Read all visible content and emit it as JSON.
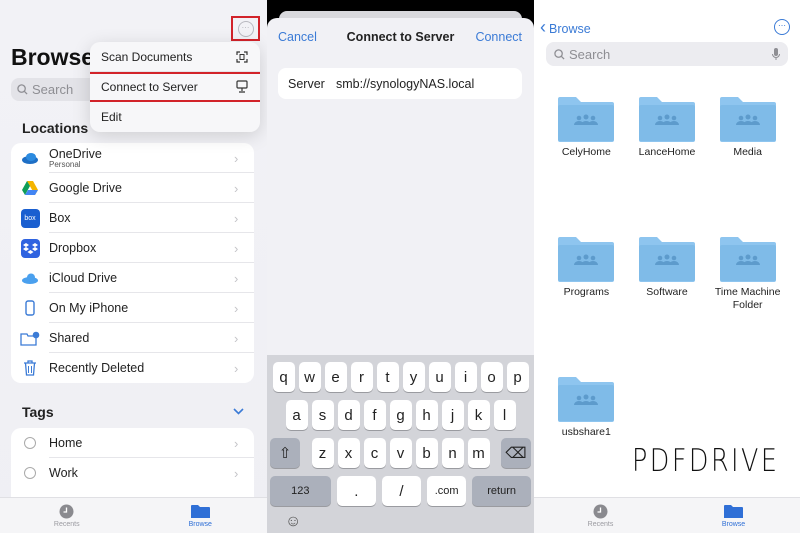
{
  "panel_browse": {
    "title": "Browse",
    "search_placeholder": "Search",
    "locations_title": "Locations",
    "locations": [
      {
        "label": "OneDrive",
        "sublabel": "Personal",
        "icon": "onedrive-icon"
      },
      {
        "label": "Google Drive",
        "icon": "google-drive-icon"
      },
      {
        "label": "Box",
        "icon": "box-icon",
        "icon_text": "box"
      },
      {
        "label": "Dropbox",
        "icon": "dropbox-icon"
      },
      {
        "label": "iCloud Drive",
        "icon": "icloud-icon"
      },
      {
        "label": "On My iPhone",
        "icon": "iphone-icon"
      },
      {
        "label": "Shared",
        "icon": "shared-folder-icon"
      },
      {
        "label": "Recently Deleted",
        "icon": "trash-icon"
      }
    ],
    "tags_title": "Tags",
    "tags": [
      {
        "label": "Home"
      },
      {
        "label": "Work"
      }
    ],
    "menu": {
      "items": [
        {
          "label": "Scan Documents",
          "icon": "scan-document-icon"
        },
        {
          "label": "Connect to Server",
          "icon": "server-display-icon",
          "highlighted": true
        },
        {
          "label": "Edit"
        }
      ]
    },
    "more_button": "⋯",
    "chevron": "›",
    "tabbar": [
      {
        "label": "Recents"
      },
      {
        "label": "Browse",
        "active": true
      }
    ]
  },
  "panel_connect": {
    "cancel_label": "Cancel",
    "title": "Connect to Server",
    "connect_label": "Connect",
    "server_label": "Server",
    "server_value": "smb://synologyNAS.local",
    "keyboard": {
      "row1": [
        "q",
        "w",
        "e",
        "r",
        "t",
        "y",
        "u",
        "i",
        "o",
        "p"
      ],
      "row2": [
        "a",
        "s",
        "d",
        "f",
        "g",
        "h",
        "j",
        "k",
        "l"
      ],
      "row3": [
        "z",
        "x",
        "c",
        "v",
        "b",
        "n",
        "m"
      ],
      "shift": "⇧",
      "backspace": "⌫",
      "numbers": "123",
      "dot": ".",
      "slash": "/",
      "dotcom": ".com",
      "return": "return",
      "emoji": "☺"
    }
  },
  "panel_server": {
    "back_label": "Browse",
    "back_chevron": "‹",
    "more_button": "⋯",
    "search_placeholder": "Search",
    "folders": [
      {
        "name": "CelyHome"
      },
      {
        "name": "LanceHome"
      },
      {
        "name": "Media"
      },
      {
        "name": "Programs"
      },
      {
        "name": "Software"
      },
      {
        "name": "Time Machine Folder"
      },
      {
        "name": "usbshare1"
      }
    ],
    "tabbar": [
      {
        "label": "Recents"
      },
      {
        "label": "Browse",
        "active": true
      }
    ]
  },
  "watermark": "PDFDRIVE",
  "colors": {
    "accent": "#3b7bd6",
    "highlight_box": "#d2232a",
    "folder": "#8ec5ef"
  }
}
